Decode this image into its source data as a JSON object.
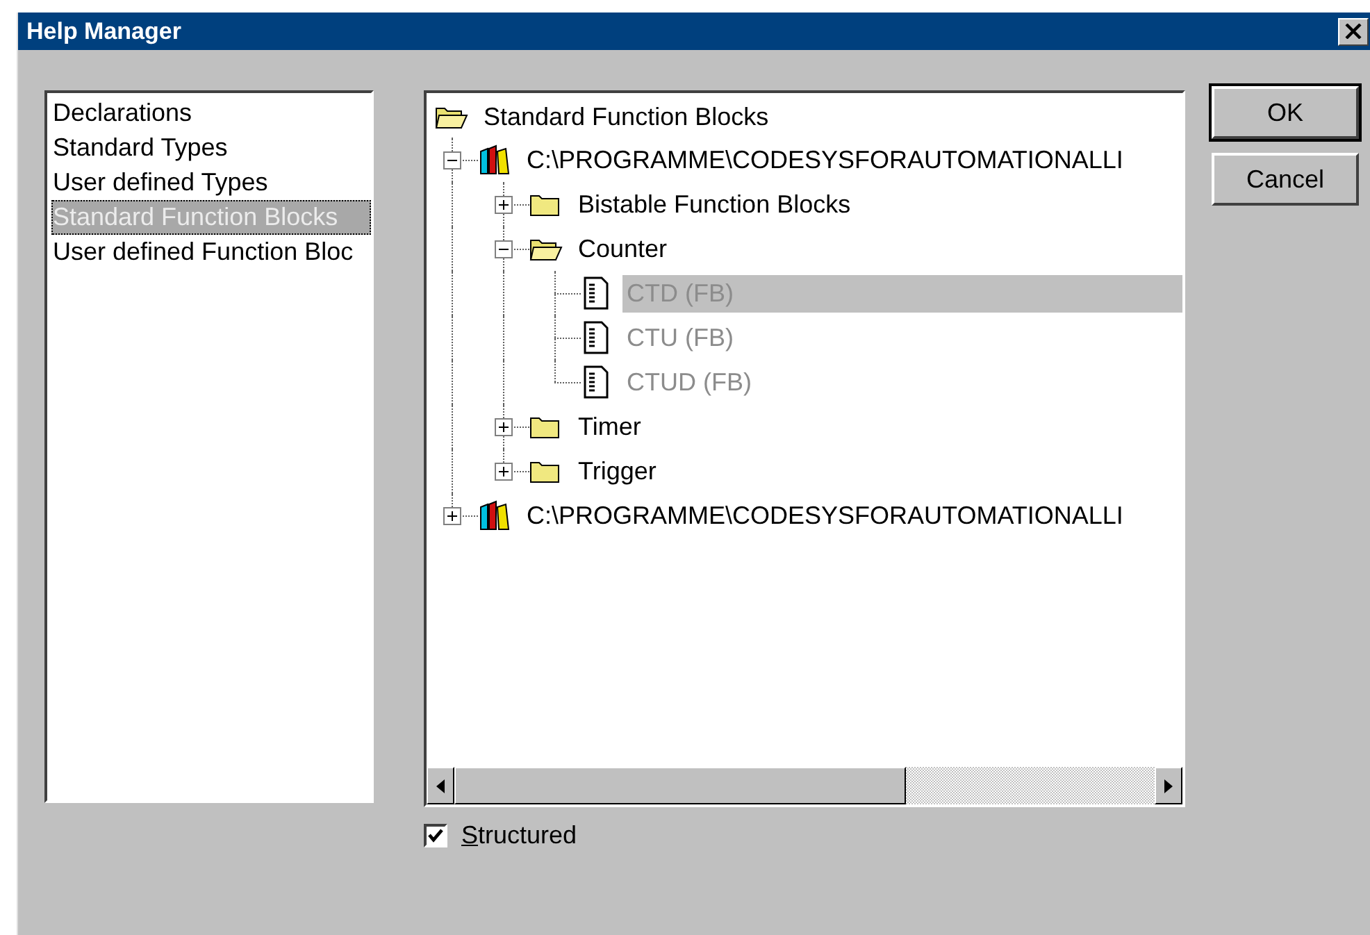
{
  "window": {
    "title": "Help Manager"
  },
  "categories": [
    {
      "label": "Declarations",
      "selected": false
    },
    {
      "label": "Standard Types",
      "selected": false
    },
    {
      "label": "User defined Types",
      "selected": false
    },
    {
      "label": "Standard Function Blocks",
      "selected": true
    },
    {
      "label": "User defined Function Bloc",
      "selected": false
    }
  ],
  "tree": {
    "root": {
      "label": "Standard Function Blocks"
    },
    "children": [
      {
        "kind": "library",
        "label": "C:\\PROGRAMME\\CODESYSFORAUTOMATIONALLI",
        "expanded": true,
        "selected": false,
        "disabled": false,
        "children": [
          {
            "kind": "folder",
            "label": "Bistable Function Blocks",
            "expanded": false,
            "selected": false,
            "disabled": false
          },
          {
            "kind": "folder",
            "label": "Counter",
            "expanded": true,
            "selected": false,
            "disabled": false,
            "children": [
              {
                "kind": "document",
                "label": "CTD (FB)",
                "selected": true,
                "disabled": true
              },
              {
                "kind": "document",
                "label": "CTU (FB)",
                "selected": false,
                "disabled": true
              },
              {
                "kind": "document",
                "label": "CTUD (FB)",
                "selected": false,
                "disabled": true
              }
            ]
          },
          {
            "kind": "folder",
            "label": "Timer",
            "expanded": false,
            "selected": false,
            "disabled": false
          },
          {
            "kind": "folder",
            "label": "Trigger",
            "expanded": false,
            "selected": false,
            "disabled": false
          }
        ]
      },
      {
        "kind": "library",
        "label": "C:\\PROGRAMME\\CODESYSFORAUTOMATIONALLI",
        "expanded": false,
        "selected": false,
        "disabled": false
      }
    ]
  },
  "buttons": [
    {
      "label": "OK",
      "default": true
    },
    {
      "label": "Cancel",
      "default": false
    }
  ],
  "structured": {
    "label": "Structured",
    "checked": true
  }
}
